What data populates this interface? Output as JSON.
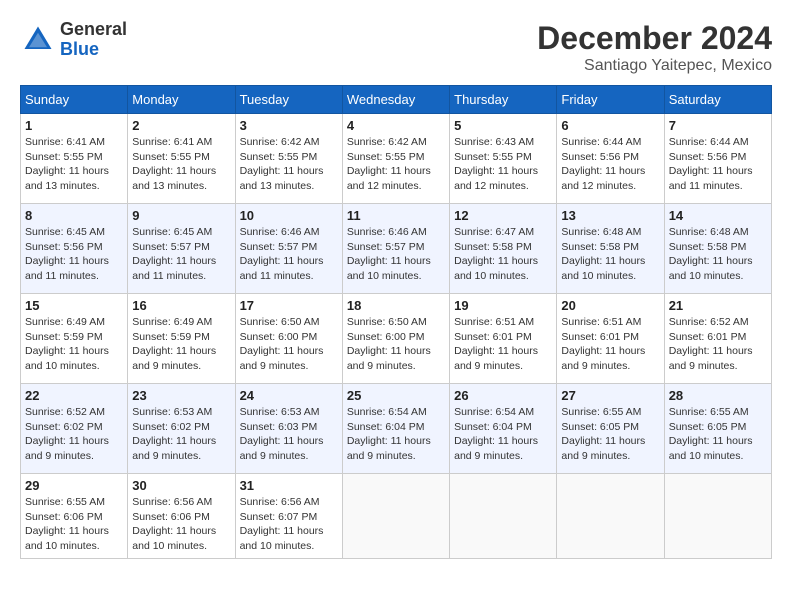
{
  "header": {
    "logo_line1": "General",
    "logo_line2": "Blue",
    "month": "December 2024",
    "location": "Santiago Yaitepec, Mexico"
  },
  "weekdays": [
    "Sunday",
    "Monday",
    "Tuesday",
    "Wednesday",
    "Thursday",
    "Friday",
    "Saturday"
  ],
  "weeks": [
    [
      {
        "day": "1",
        "sunrise": "6:41 AM",
        "sunset": "5:55 PM",
        "daylight": "11 hours and 13 minutes."
      },
      {
        "day": "2",
        "sunrise": "6:41 AM",
        "sunset": "5:55 PM",
        "daylight": "11 hours and 13 minutes."
      },
      {
        "day": "3",
        "sunrise": "6:42 AM",
        "sunset": "5:55 PM",
        "daylight": "11 hours and 13 minutes."
      },
      {
        "day": "4",
        "sunrise": "6:42 AM",
        "sunset": "5:55 PM",
        "daylight": "11 hours and 12 minutes."
      },
      {
        "day": "5",
        "sunrise": "6:43 AM",
        "sunset": "5:55 PM",
        "daylight": "11 hours and 12 minutes."
      },
      {
        "day": "6",
        "sunrise": "6:44 AM",
        "sunset": "5:56 PM",
        "daylight": "11 hours and 12 minutes."
      },
      {
        "day": "7",
        "sunrise": "6:44 AM",
        "sunset": "5:56 PM",
        "daylight": "11 hours and 11 minutes."
      }
    ],
    [
      {
        "day": "8",
        "sunrise": "6:45 AM",
        "sunset": "5:56 PM",
        "daylight": "11 hours and 11 minutes."
      },
      {
        "day": "9",
        "sunrise": "6:45 AM",
        "sunset": "5:57 PM",
        "daylight": "11 hours and 11 minutes."
      },
      {
        "day": "10",
        "sunrise": "6:46 AM",
        "sunset": "5:57 PM",
        "daylight": "11 hours and 11 minutes."
      },
      {
        "day": "11",
        "sunrise": "6:46 AM",
        "sunset": "5:57 PM",
        "daylight": "11 hours and 10 minutes."
      },
      {
        "day": "12",
        "sunrise": "6:47 AM",
        "sunset": "5:58 PM",
        "daylight": "11 hours and 10 minutes."
      },
      {
        "day": "13",
        "sunrise": "6:48 AM",
        "sunset": "5:58 PM",
        "daylight": "11 hours and 10 minutes."
      },
      {
        "day": "14",
        "sunrise": "6:48 AM",
        "sunset": "5:58 PM",
        "daylight": "11 hours and 10 minutes."
      }
    ],
    [
      {
        "day": "15",
        "sunrise": "6:49 AM",
        "sunset": "5:59 PM",
        "daylight": "11 hours and 10 minutes."
      },
      {
        "day": "16",
        "sunrise": "6:49 AM",
        "sunset": "5:59 PM",
        "daylight": "11 hours and 9 minutes."
      },
      {
        "day": "17",
        "sunrise": "6:50 AM",
        "sunset": "6:00 PM",
        "daylight": "11 hours and 9 minutes."
      },
      {
        "day": "18",
        "sunrise": "6:50 AM",
        "sunset": "6:00 PM",
        "daylight": "11 hours and 9 minutes."
      },
      {
        "day": "19",
        "sunrise": "6:51 AM",
        "sunset": "6:01 PM",
        "daylight": "11 hours and 9 minutes."
      },
      {
        "day": "20",
        "sunrise": "6:51 AM",
        "sunset": "6:01 PM",
        "daylight": "11 hours and 9 minutes."
      },
      {
        "day": "21",
        "sunrise": "6:52 AM",
        "sunset": "6:01 PM",
        "daylight": "11 hours and 9 minutes."
      }
    ],
    [
      {
        "day": "22",
        "sunrise": "6:52 AM",
        "sunset": "6:02 PM",
        "daylight": "11 hours and 9 minutes."
      },
      {
        "day": "23",
        "sunrise": "6:53 AM",
        "sunset": "6:02 PM",
        "daylight": "11 hours and 9 minutes."
      },
      {
        "day": "24",
        "sunrise": "6:53 AM",
        "sunset": "6:03 PM",
        "daylight": "11 hours and 9 minutes."
      },
      {
        "day": "25",
        "sunrise": "6:54 AM",
        "sunset": "6:04 PM",
        "daylight": "11 hours and 9 minutes."
      },
      {
        "day": "26",
        "sunrise": "6:54 AM",
        "sunset": "6:04 PM",
        "daylight": "11 hours and 9 minutes."
      },
      {
        "day": "27",
        "sunrise": "6:55 AM",
        "sunset": "6:05 PM",
        "daylight": "11 hours and 9 minutes."
      },
      {
        "day": "28",
        "sunrise": "6:55 AM",
        "sunset": "6:05 PM",
        "daylight": "11 hours and 10 minutes."
      }
    ],
    [
      {
        "day": "29",
        "sunrise": "6:55 AM",
        "sunset": "6:06 PM",
        "daylight": "11 hours and 10 minutes."
      },
      {
        "day": "30",
        "sunrise": "6:56 AM",
        "sunset": "6:06 PM",
        "daylight": "11 hours and 10 minutes."
      },
      {
        "day": "31",
        "sunrise": "6:56 AM",
        "sunset": "6:07 PM",
        "daylight": "11 hours and 10 minutes."
      },
      null,
      null,
      null,
      null
    ]
  ]
}
